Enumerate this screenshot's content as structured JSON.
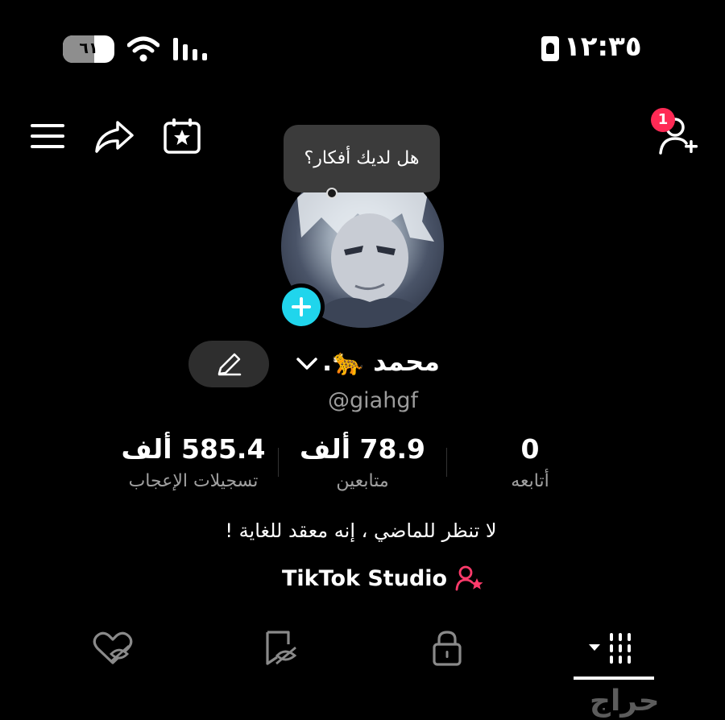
{
  "status_bar": {
    "time": "١٢:٣٥",
    "battery_level": "٦١",
    "battery_fraction": 0.61
  },
  "top_bar": {
    "notification_count": "1"
  },
  "tooltip": {
    "text": "هل لديك أفكار؟"
  },
  "profile": {
    "display_name": "محمد 🐆.",
    "username": "@giahgf",
    "bio": "لا تنظر للماضي ، إنه معقد للغاية !",
    "studio_link": "TikTok Studio"
  },
  "stats": [
    {
      "value": "585.4 ألف",
      "label": "تسجيلات الإعجاب"
    },
    {
      "value": "78.9 ألف",
      "label": "متابعين"
    },
    {
      "value": "0",
      "label": "أتابعه"
    }
  ],
  "tabs": [
    {
      "icon": "liked-hidden-icon"
    },
    {
      "icon": "favorites-hidden-icon"
    },
    {
      "icon": "lock-icon"
    },
    {
      "icon": "videos-grid-icon",
      "selected": true
    }
  ],
  "watermark": "حراج",
  "colors": {
    "background": "#000000",
    "accent_cyan": "#20d5ec",
    "badge_red": "#ff2a55",
    "studio_pink": "#ff3b6b"
  }
}
